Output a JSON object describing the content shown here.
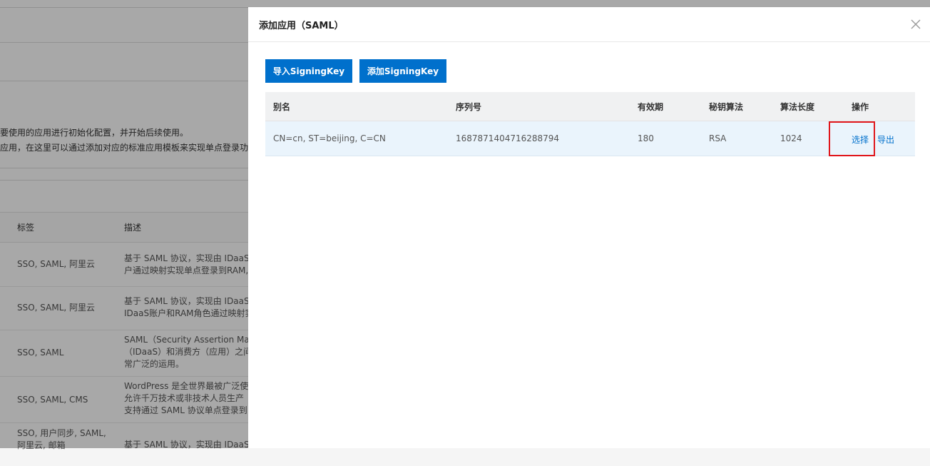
{
  "background": {
    "notice_lines": [
      "要使用的应用进行初始化配置，并开始后续使用。",
      "应用，在这里可以通过添加对应的标准应用模板来实现单点登录功"
    ],
    "table": {
      "headers": {
        "tags": "标签",
        "desc": "描述"
      },
      "rows": [
        {
          "tags": "SSO, SAML, 阿里云",
          "desc": [
            "基于 SAML 协议，实现由 IDaaS",
            "户通过映射实现单点登录到RAM,"
          ]
        },
        {
          "tags": "SSO, SAML, 阿里云",
          "desc": [
            "基于 SAML 协议，实现由 IDaaS",
            "IDaaS账户和RAM角色通过映射实"
          ]
        },
        {
          "tags": "SSO, SAML",
          "desc": [
            "SAML（Security Assertion Marku",
            "（IDaaS）和消费方（应用）之间",
            "常广泛的运用。"
          ]
        },
        {
          "tags": "SSO, SAML, CMS",
          "desc": [
            "WordPress 是全世界最被广泛使用",
            "允许千万技术或非技术人员生产",
            "支持通过 SAML 协议单点登录到"
          ]
        },
        {
          "tags": [
            "SSO, 用户同步, SAML,",
            "阿里云, 邮箱"
          ],
          "desc": [
            "基于 SAML 协议，实现由 IDaaS"
          ]
        }
      ]
    }
  },
  "drawer": {
    "title": "添加应用（SAML）",
    "close_icon": "close-icon",
    "buttons": {
      "import": "导入SigningKey",
      "add": "添加SigningKey"
    },
    "table": {
      "headers": {
        "alias": "别名",
        "serial": "序列号",
        "validity": "有效期",
        "algorithm": "秘钥算法",
        "length": "算法长度",
        "actions": "操作"
      },
      "rows": [
        {
          "alias": "CN=cn, ST=beijing, C=CN",
          "serial": "1687871404716288794",
          "validity": "180",
          "algorithm": "RSA",
          "length": "1024",
          "action_select": "选择",
          "action_export": "导出"
        }
      ]
    }
  },
  "colors": {
    "primary": "#0070cc",
    "highlight": "#e0161b",
    "row_bg": "#eaf4fc"
  }
}
